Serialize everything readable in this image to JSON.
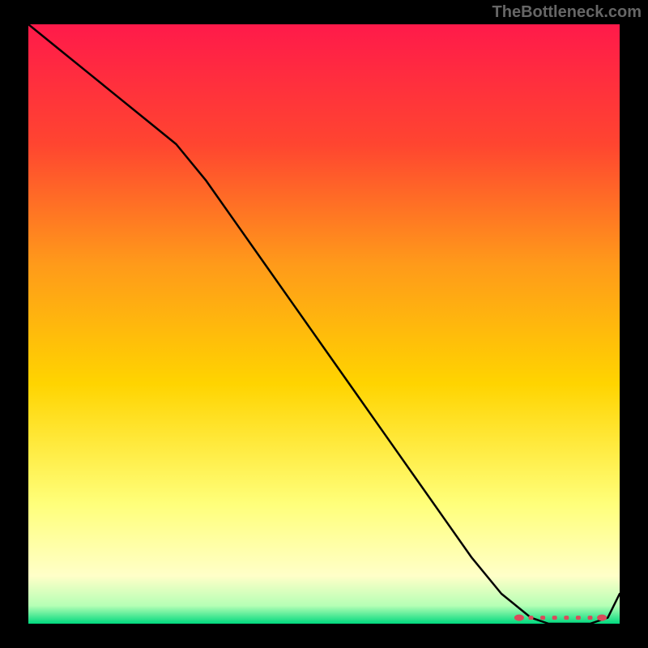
{
  "watermark": "TheBottleneck.com",
  "chart_data": {
    "type": "line",
    "title": "",
    "xlabel": "",
    "ylabel": "",
    "x": [
      0,
      5,
      10,
      15,
      20,
      25,
      30,
      35,
      40,
      45,
      50,
      55,
      60,
      65,
      70,
      75,
      80,
      85,
      88,
      90,
      92,
      95,
      98,
      100
    ],
    "y": [
      100,
      96,
      92,
      88,
      84,
      80,
      74,
      67,
      60,
      53,
      46,
      39,
      32,
      25,
      18,
      11,
      5,
      1,
      0,
      0,
      0,
      0,
      1,
      5
    ],
    "xlim": [
      0,
      100
    ],
    "ylim": [
      0,
      100
    ],
    "annotations": [
      {
        "type": "marker-band",
        "x_start": 83,
        "x_end": 97,
        "y": 1
      }
    ],
    "background": "thermal-gradient",
    "colors": {
      "top": "#ff1a4a",
      "upper_mid": "#ff6b2b",
      "mid": "#ffd400",
      "lower_mid": "#ffff8a",
      "bottom": "#00d97e",
      "marker": "#d94b5b"
    }
  }
}
